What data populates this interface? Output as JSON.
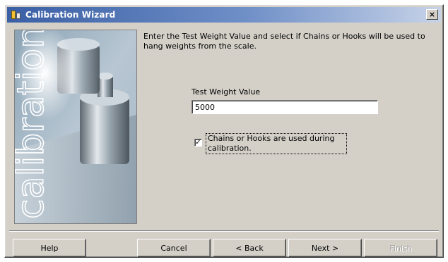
{
  "window": {
    "title": "Calibration Wizard",
    "close_glyph": "×",
    "icon": "scale-icon"
  },
  "side_image": {
    "word": "calibration"
  },
  "content": {
    "intro_text": "Enter the Test Weight Value and select if Chains or Hooks will be used to hang weights from the scale.",
    "weight_label": "Test Weight Value",
    "weight_value": "5000",
    "chains_checkbox_checked": true,
    "chains_label": "Chains or Hooks are used during calibration."
  },
  "buttons": {
    "help": "Help",
    "cancel": "Cancel",
    "back": "< Back",
    "next": "Next >",
    "finish": "Finish"
  },
  "colors": {
    "titlebar_start": "#3a5fa5",
    "titlebar_end": "#c7d3e8",
    "face": "#d4d0c8"
  }
}
